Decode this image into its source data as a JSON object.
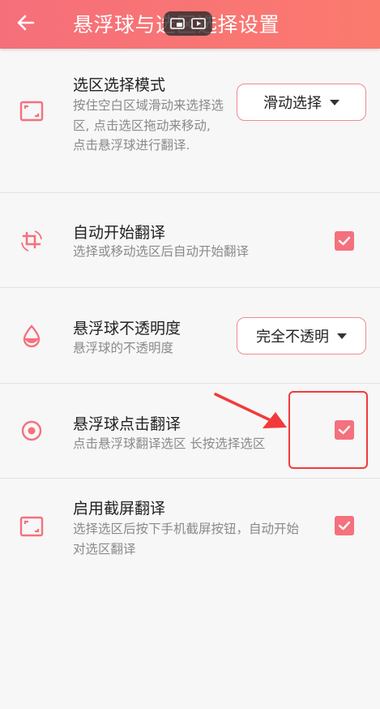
{
  "appbar": {
    "title": "悬浮球与选区选择设置",
    "back_icon": "arrow-left-icon"
  },
  "colors": {
    "accent": "#f4717d",
    "appbar_start": "#f56f7b",
    "appbar_end": "#fb7a6e",
    "annotation": "#f23a3a"
  },
  "settings": [
    {
      "title": "选区选择模式",
      "desc": "按住空白区域滑动来选择选区, 点击选区拖动来移动, 点击悬浮球进行翻译.",
      "icon": "selection-frame-icon",
      "control": "dropdown",
      "value": "滑动选择"
    },
    {
      "title": "自动开始翻译",
      "desc": "选择或移动选区后自动开始翻译",
      "icon": "crop-rotate-icon",
      "control": "checkbox",
      "checked": true
    },
    {
      "title": "悬浮球不透明度",
      "desc": "悬浮球的不透明度",
      "icon": "opacity-drop-icon",
      "control": "dropdown",
      "value": "完全不透明"
    },
    {
      "title": "悬浮球点击翻译",
      "desc": "点击悬浮球翻译选区 长按选择选区",
      "icon": "target-circle-icon",
      "control": "checkbox",
      "checked": true
    },
    {
      "title": "启用截屏翻译",
      "desc": "选择选区后按下手机截屏按钮，自动开始对选区翻译",
      "icon": "selection-frame-icon",
      "control": "checkbox",
      "checked": true
    }
  ]
}
